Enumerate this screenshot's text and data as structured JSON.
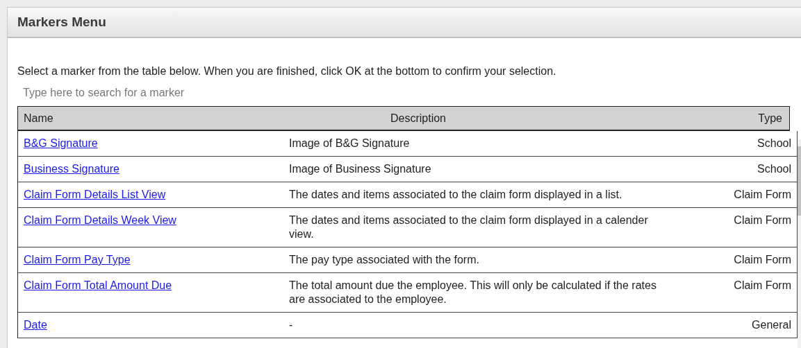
{
  "dialog": {
    "title": "Markers Menu"
  },
  "instructions": "Select a marker from the table below. When you are finished, click OK at the bottom to confirm your selection.",
  "search": {
    "placeholder": "Type here to search for a marker"
  },
  "table": {
    "columns": [
      "Name",
      "Description",
      "Type"
    ],
    "rows": [
      {
        "name": "B&G Signature",
        "description": "Image of B&G Signature",
        "type": "School"
      },
      {
        "name": "Business Signature",
        "description": "Image of Business Signature",
        "type": "School"
      },
      {
        "name": "Claim Form Details List View",
        "description": "The dates and items associated to the claim form displayed in a list.",
        "type": "Claim Form"
      },
      {
        "name": "Claim Form Details Week View",
        "description": "The dates and items associated to the claim form displayed in a calender view.",
        "type": "Claim Form"
      },
      {
        "name": "Claim Form Pay Type",
        "description": "The pay type associated with the form.",
        "type": "Claim Form"
      },
      {
        "name": "Claim Form Total Amount Due",
        "description": "The total amount due the employee.  This will only be calculated if the rates are associated to the employee.",
        "type": "Claim Form"
      },
      {
        "name": "Date",
        "description": "-",
        "type": "General"
      }
    ]
  }
}
